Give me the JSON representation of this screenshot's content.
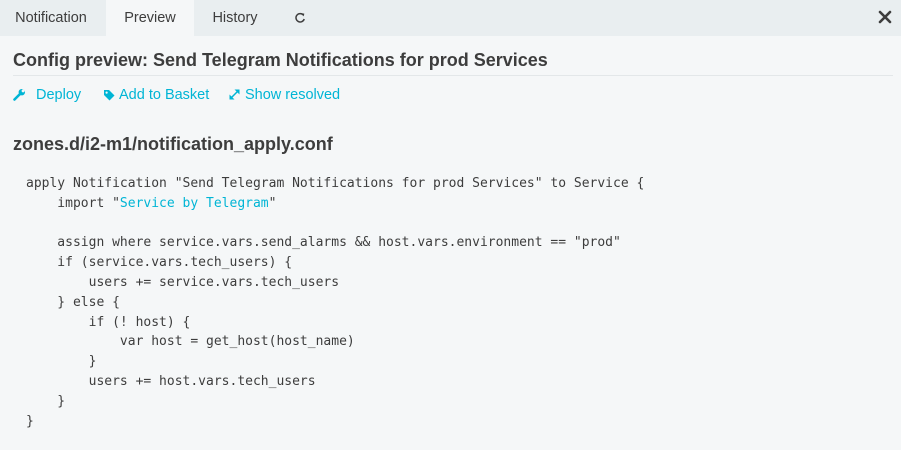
{
  "tabs": {
    "notification": "Notification",
    "preview": "Preview",
    "history": "History",
    "refresh_icon": "refresh-icon"
  },
  "close_icon": "close-icon",
  "title": "Config preview: Send Telegram Notifications for prod Services",
  "actions": {
    "deploy": "Deploy",
    "add_to_basket": "Add to Basket",
    "show_resolved": "Show resolved"
  },
  "file": {
    "path": "zones.d/i2-m1/notification_apply.conf",
    "code": {
      "l1": "apply Notification \"Send Telegram Notifications for prod Services\" to Service {",
      "l2_pre": "    import \"",
      "l2_link": "Service by Telegram",
      "l2_post": "\"",
      "l3": "",
      "l4": "    assign where service.vars.send_alarms && host.vars.environment == \"prod\"",
      "l5": "    if (service.vars.tech_users) {",
      "l6": "        users += service.vars.tech_users",
      "l7": "    } else {",
      "l8": "        if (! host) {",
      "l9": "            var host = get_host(host_name)",
      "l10": "        }",
      "l11": "        users += host.vars.tech_users",
      "l12": "    }",
      "l13": "}"
    }
  },
  "colors": {
    "accent": "#00b5d5",
    "text": "#3d3d3d",
    "tabbar_bg": "#e9eef0",
    "page_bg": "#f5f7f8"
  }
}
